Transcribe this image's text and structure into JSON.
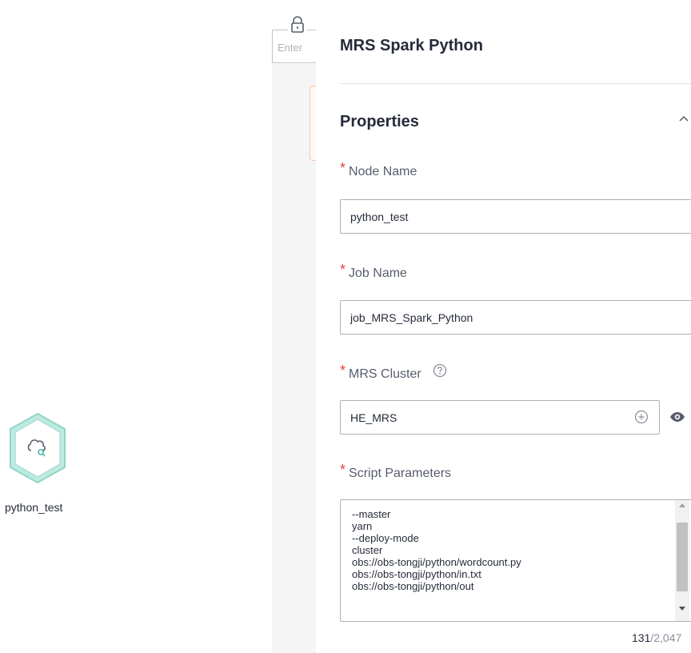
{
  "canvas": {
    "search_placeholder": "Enter",
    "node": {
      "label": "python_test",
      "icon": "spark-python-node-icon",
      "color": "#8fd6c8"
    }
  },
  "panel": {
    "title": "MRS Spark Python",
    "section_title": "Properties",
    "fields": {
      "node_name": {
        "label": "Node Name",
        "value": "python_test"
      },
      "job_name": {
        "label": "Job Name",
        "value": "job_MRS_Spark_Python"
      },
      "mrs_cluster": {
        "label": "MRS Cluster",
        "value": "HE_MRS"
      },
      "script_parameters": {
        "label": "Script Parameters",
        "lines": [
          "--master",
          "yarn",
          "--deploy-mode",
          "cluster",
          "obs://obs-tongji/python/wordcount.py",
          "obs://obs-tongji/python/in.txt",
          "obs://obs-tongji/python/out"
        ],
        "count_current": "131",
        "count_max": "/2,047"
      }
    },
    "required_marker": "*"
  },
  "colors": {
    "required": "#e54545",
    "text": "#252b3a",
    "label": "#575d6c",
    "border": "#adb0b8"
  }
}
